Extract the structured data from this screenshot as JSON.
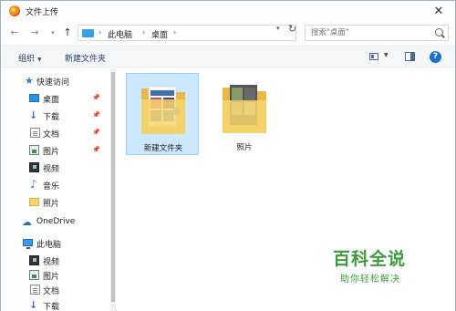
{
  "window": {
    "title": "文件上传",
    "icon": "firefox-icon",
    "close_glyph": "✕"
  },
  "address": {
    "back_glyph": "←",
    "forward_glyph": "→",
    "recent_glyph": "▾",
    "up_glyph": "↑",
    "crumbs": [
      "此电脑",
      "桌面"
    ],
    "sep_glyph": "›",
    "dropdown_glyph": "▾",
    "refresh_glyph": "↻"
  },
  "search": {
    "placeholder": "搜索\"桌面\""
  },
  "toolbar": {
    "organize_label": "组织",
    "new_folder_label": "新建文件夹",
    "dd_glyph": "▼",
    "help_glyph": "?"
  },
  "nav": {
    "items": [
      {
        "label": "快速访问",
        "icon": "star-icon",
        "pinned": false
      },
      {
        "label": "桌面",
        "icon": "desktop-icon",
        "pinned": true
      },
      {
        "label": "下载",
        "icon": "download-icon",
        "pinned": true
      },
      {
        "label": "文档",
        "icon": "document-icon",
        "pinned": true
      },
      {
        "label": "图片",
        "icon": "pictures-icon",
        "pinned": true
      },
      {
        "label": "视频",
        "icon": "video-icon",
        "pinned": false
      },
      {
        "label": "音乐",
        "icon": "music-icon",
        "pinned": false
      },
      {
        "label": "照片",
        "icon": "folder-icon",
        "pinned": false
      },
      {
        "label": "OneDrive",
        "icon": "cloud-icon",
        "pinned": false
      },
      {
        "label": "此电脑",
        "icon": "pc-icon",
        "pinned": false
      },
      {
        "label": "视频",
        "icon": "video-icon",
        "pinned": false
      },
      {
        "label": "图片",
        "icon": "pictures-icon",
        "pinned": false
      },
      {
        "label": "文档",
        "icon": "document-icon",
        "pinned": false
      },
      {
        "label": "下载",
        "icon": "download-icon",
        "pinned": false
      }
    ],
    "pin_glyph": "📌",
    "star_glyph": "★",
    "download_glyph": "↓",
    "music_glyph": "♪",
    "cloud_glyph": "☁"
  },
  "files": [
    {
      "name": "新建文件夹",
      "selected": true
    },
    {
      "name": "照片",
      "selected": false
    }
  ],
  "watermark": {
    "title": "百科全说",
    "subtitle": "助你轻松解决"
  },
  "colors": {
    "accent": "#1f6fd0",
    "selection": "#cce8ff",
    "folder": "#f7d66f",
    "watermark": "#3c9a3c"
  }
}
